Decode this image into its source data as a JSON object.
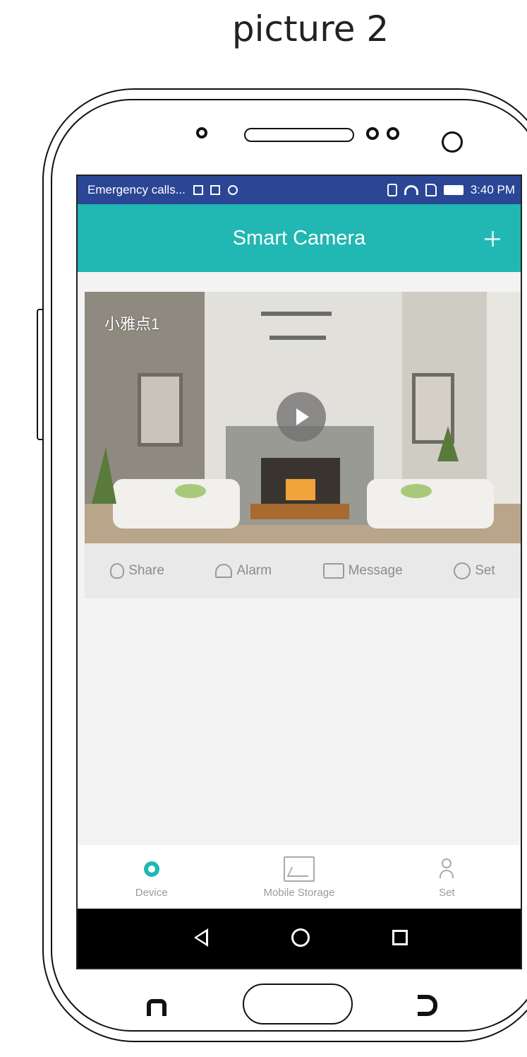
{
  "caption": "picture 2",
  "status_bar": {
    "carrier_text": "Emergency calls...",
    "time": "3:40 PM"
  },
  "app_bar": {
    "title": "Smart Camera",
    "add_icon": "plus-icon"
  },
  "device": {
    "name": "小雅点1",
    "actions": [
      {
        "label": "Share",
        "icon": "share-icon"
      },
      {
        "label": "Alarm",
        "icon": "alarm-icon"
      },
      {
        "label": "Message",
        "icon": "message-icon"
      },
      {
        "label": "Set",
        "icon": "settings-icon"
      }
    ]
  },
  "bottom_nav": [
    {
      "label": "Device",
      "icon": "camera-location-icon",
      "active": true
    },
    {
      "label": "Mobile Storage",
      "icon": "image-icon",
      "active": false
    },
    {
      "label": "Set",
      "icon": "user-icon",
      "active": false
    }
  ],
  "colors": {
    "status_bar": "#2c4696",
    "app_bar": "#21b7b2",
    "accent": "#21b7b2"
  }
}
